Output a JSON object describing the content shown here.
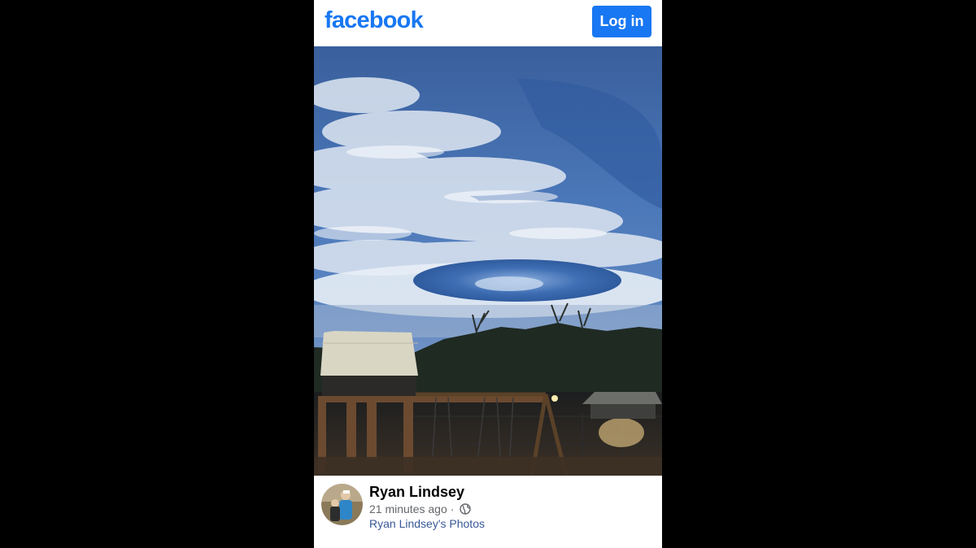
{
  "header": {
    "logo_text": "facebook",
    "login_label": "Log in"
  },
  "photo": {
    "icon": "sky-photo"
  },
  "post": {
    "author_name": "Ryan Lindsey",
    "timestamp": "21 minutes ago",
    "separator": "·",
    "privacy_icon": "globe-icon",
    "album_link": "Ryan Lindsey's Photos"
  },
  "colors": {
    "brand": "#1877f2",
    "link": "#385898",
    "meta": "#65676b"
  }
}
